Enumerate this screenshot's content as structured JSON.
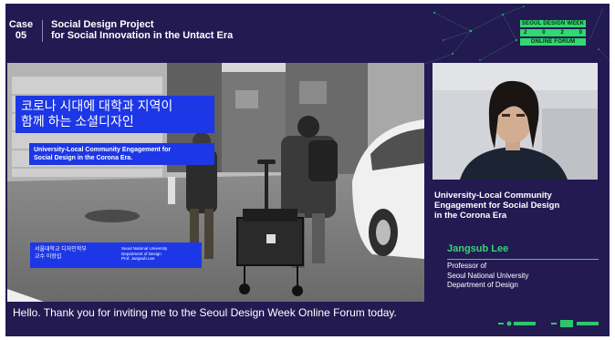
{
  "header": {
    "case_label": "Case",
    "case_number": "05",
    "title_line1": "Social Design Project",
    "title_line2": "for Social Innovation in the Untact Era"
  },
  "event_logo": {
    "line1": "SEOUL DESIGN WEEK",
    "year": [
      "2",
      "0",
      "2",
      "0"
    ],
    "line3": "ONLINE FORUM",
    "color": "#31d873"
  },
  "slide": {
    "title_ko_line1": "코로나 시대에 대학과 지역이",
    "title_ko_line2": "함께 하는 소셜디자인",
    "title_en_line1": "University-Local Community Engagement for",
    "title_en_line2": "Social Design in the Corona Era.",
    "caption_ko_line1": "서울대학교 디자인학부",
    "caption_ko_line2": "교수 이장섭",
    "caption_en_line1": "Seoul National University",
    "caption_en_line2": "Department of Design",
    "caption_en_line3": "Prof. Jangsub Lee",
    "box_color": "#1d37e6"
  },
  "talk": {
    "title_line1": "University-Local Community",
    "title_line2": "Engagement for Social Design",
    "title_line3": "in the Corona Era"
  },
  "speaker": {
    "name": "Jangsub Lee",
    "role_line1": "Professor of",
    "role_line2": "Seoul National University",
    "role_line3": "Department of Design"
  },
  "subtitle": "Hello. Thank you for inviting me to the Seoul Design Week Online Forum today.",
  "colors": {
    "background": "#231a52",
    "accent": "#31d873"
  }
}
